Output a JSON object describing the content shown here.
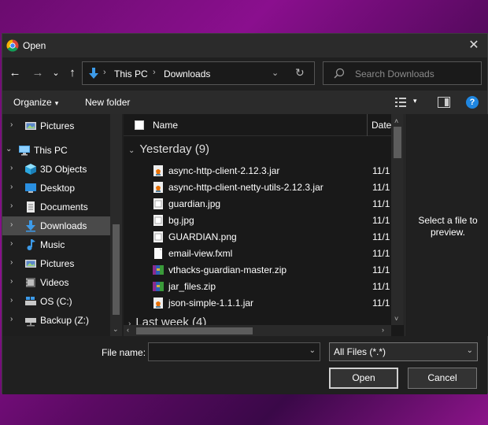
{
  "window": {
    "title": "Open",
    "close_label": "✕",
    "icon": "chrome-icon"
  },
  "nav": {
    "back": "←",
    "forward": "→",
    "recent": "⌄",
    "up": "↑"
  },
  "address": {
    "crumbs": [
      "This PC",
      "Downloads"
    ],
    "separator": "›",
    "dropdown": "⌄",
    "refresh": "↻"
  },
  "search": {
    "placeholder": "Search Downloads"
  },
  "toolbar": {
    "organize_label": "Organize",
    "new_folder_label": "New folder",
    "caret": "▾",
    "help": "?"
  },
  "navpane": {
    "items": [
      {
        "label": "Pictures",
        "icon": "pictures-icon",
        "indent": 1,
        "expanded": false
      },
      {
        "label": "This PC",
        "icon": "pc-icon",
        "indent": 0,
        "expanded": true
      },
      {
        "label": "3D Objects",
        "icon": "3d-objects-icon",
        "indent": 1
      },
      {
        "label": "Desktop",
        "icon": "desktop-icon",
        "indent": 1
      },
      {
        "label": "Documents",
        "icon": "documents-icon",
        "indent": 1
      },
      {
        "label": "Downloads",
        "icon": "downloads-icon",
        "indent": 1,
        "selected": true
      },
      {
        "label": "Music",
        "icon": "music-icon",
        "indent": 1
      },
      {
        "label": "Pictures",
        "icon": "pictures-icon",
        "indent": 1
      },
      {
        "label": "Videos",
        "icon": "videos-icon",
        "indent": 1
      },
      {
        "label": "OS (C:)",
        "icon": "drive-icon",
        "indent": 1
      },
      {
        "label": "Backup (Z:)",
        "icon": "network-drive-icon",
        "indent": 1
      }
    ]
  },
  "filelist": {
    "columns": {
      "name": "Name",
      "date": "Date"
    },
    "groups": [
      {
        "label": "Yesterday (9)"
      },
      {
        "label": "Last week (4)"
      }
    ],
    "files": [
      {
        "name": "async-http-client-2.12.3.jar",
        "date": "11/1",
        "icon": "jar-icon"
      },
      {
        "name": "async-http-client-netty-utils-2.12.3.jar",
        "date": "11/1",
        "icon": "jar-icon"
      },
      {
        "name": "guardian.jpg",
        "date": "11/1",
        "icon": "image-file-icon"
      },
      {
        "name": "bg.jpg",
        "date": "11/1",
        "icon": "image-file-icon"
      },
      {
        "name": "GUARDIAN.png",
        "date": "11/1",
        "icon": "image-file-icon"
      },
      {
        "name": "email-view.fxml",
        "date": "11/1",
        "icon": "document-file-icon"
      },
      {
        "name": "vthacks-guardian-master.zip",
        "date": "11/1",
        "icon": "zip-icon"
      },
      {
        "name": "jar_files.zip",
        "date": "11/1",
        "icon": "zip-icon"
      },
      {
        "name": "json-simple-1.1.1.jar",
        "date": "11/1",
        "icon": "jar-icon"
      }
    ]
  },
  "preview": {
    "text": "Select a file to preview."
  },
  "bottom": {
    "file_name_label": "File name:",
    "file_name_value": "",
    "file_type_value": "All Files (*.*)",
    "open_label": "Open",
    "cancel_label": "Cancel"
  },
  "colors": {
    "accent": "#1f86e0",
    "dialog_bg": "#202020",
    "selected_bg": "#4a4a4a"
  }
}
